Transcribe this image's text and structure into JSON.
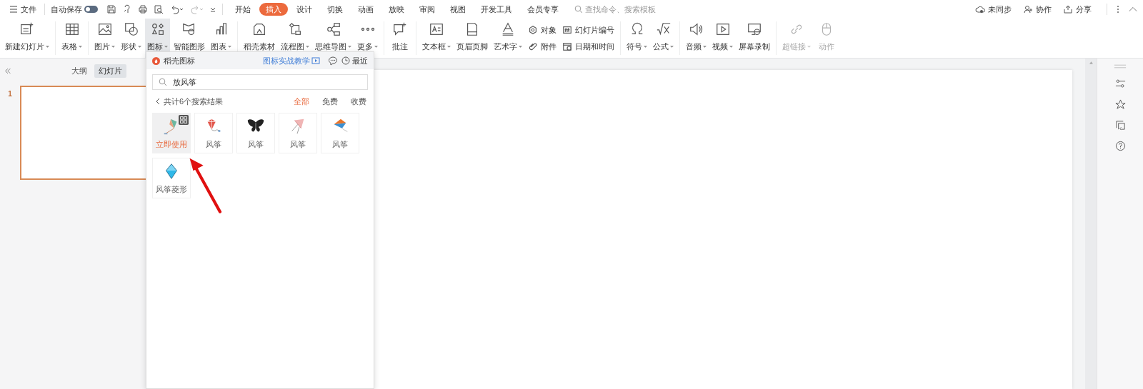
{
  "top_bar": {
    "menu": {
      "label": "文件"
    },
    "autosave": {
      "label": "自动保存",
      "on": false
    },
    "tabs": [
      {
        "label": "开始",
        "selected": false
      },
      {
        "label": "插入",
        "selected": true
      },
      {
        "label": "设计",
        "selected": false
      },
      {
        "label": "切换",
        "selected": false
      },
      {
        "label": "动画",
        "selected": false
      },
      {
        "label": "放映",
        "selected": false
      },
      {
        "label": "审阅",
        "selected": false
      },
      {
        "label": "视图",
        "selected": false
      },
      {
        "label": "开发工具",
        "selected": false
      },
      {
        "label": "会员专享",
        "selected": false
      }
    ],
    "search": {
      "placeholder": "查找命令、搜索模板"
    },
    "actions": [
      {
        "label": "未同步"
      },
      {
        "label": "协作"
      },
      {
        "label": "分享"
      }
    ]
  },
  "ribbon": {
    "groups": [
      [
        {
          "kind": "large",
          "label": "新建幻灯片",
          "dropdown": true,
          "selected": false,
          "disabled": false
        }
      ],
      [
        {
          "kind": "large",
          "label": "表格",
          "dropdown": true,
          "selected": false,
          "disabled": false
        }
      ],
      [
        {
          "kind": "large",
          "label": "图片",
          "dropdown": true,
          "selected": false,
          "disabled": false
        },
        {
          "kind": "large",
          "label": "形状",
          "dropdown": true,
          "selected": false,
          "disabled": false
        },
        {
          "kind": "large",
          "label": "图标",
          "dropdown": true,
          "selected": true,
          "disabled": false
        },
        {
          "kind": "large",
          "label": "智能图形",
          "dropdown": false,
          "selected": false,
          "disabled": false
        },
        {
          "kind": "large",
          "label": "图表",
          "dropdown": true,
          "selected": false,
          "disabled": false
        }
      ],
      [
        {
          "kind": "large",
          "label": "稻壳素材",
          "dropdown": false,
          "selected": false,
          "disabled": false
        },
        {
          "kind": "large",
          "label": "流程图",
          "dropdown": true,
          "selected": false,
          "disabled": false
        },
        {
          "kind": "large",
          "label": "思维导图",
          "dropdown": true,
          "selected": false,
          "disabled": false
        },
        {
          "kind": "large",
          "label": "更多",
          "dropdown": true,
          "selected": false,
          "disabled": false
        }
      ],
      [
        {
          "kind": "large",
          "label": "批注",
          "dropdown": false,
          "selected": false,
          "disabled": false
        }
      ],
      [
        {
          "kind": "large",
          "label": "文本框",
          "dropdown": true,
          "selected": false,
          "disabled": false
        },
        {
          "kind": "large",
          "label": "页眉页脚",
          "dropdown": false,
          "selected": false,
          "disabled": false
        },
        {
          "kind": "large",
          "label": "艺术字",
          "dropdown": true,
          "selected": false,
          "disabled": false
        },
        {
          "kind": "stack",
          "items": [
            {
              "label": "对象"
            },
            {
              "label": "附件"
            }
          ]
        },
        {
          "kind": "stack",
          "items": [
            {
              "label": "幻灯片编号"
            },
            {
              "label": "日期和时间"
            }
          ]
        }
      ],
      [
        {
          "kind": "large",
          "label": "符号",
          "dropdown": true,
          "selected": false,
          "disabled": false
        },
        {
          "kind": "large",
          "label": "公式",
          "dropdown": true,
          "selected": false,
          "disabled": false
        }
      ],
      [
        {
          "kind": "large",
          "label": "音频",
          "dropdown": true,
          "selected": false,
          "disabled": false
        },
        {
          "kind": "large",
          "label": "视频",
          "dropdown": true,
          "selected": false,
          "disabled": false
        },
        {
          "kind": "large",
          "label": "屏幕录制",
          "dropdown": false,
          "selected": false,
          "disabled": false
        }
      ],
      [
        {
          "kind": "large",
          "label": "超链接",
          "dropdown": true,
          "selected": false,
          "disabled": true
        },
        {
          "kind": "large",
          "label": "动作",
          "dropdown": false,
          "selected": false,
          "disabled": true
        }
      ]
    ]
  },
  "sidebar": {
    "tabs": [
      {
        "label": "大纲",
        "selected": false
      },
      {
        "label": "幻灯片",
        "selected": true
      }
    ],
    "slides": [
      {
        "number": "1",
        "selected": true
      }
    ]
  },
  "icon_panel": {
    "title": "稻壳图标",
    "tutorial_link": "图标实战教学",
    "recent": "最近",
    "search": {
      "value": "放风筝"
    },
    "result_count": "共计6个搜索结果",
    "filters": [
      {
        "label": "全部",
        "selected": true
      },
      {
        "label": "免费",
        "selected": false
      },
      {
        "label": "收费",
        "selected": false
      }
    ],
    "results": [
      {
        "label": "立即使用",
        "hovered": true
      },
      {
        "label": "风筝",
        "hovered": false
      },
      {
        "label": "风筝",
        "hovered": false
      },
      {
        "label": "风筝",
        "hovered": false
      },
      {
        "label": "风筝",
        "hovered": false
      },
      {
        "label": "风筝菱形",
        "hovered": false
      }
    ]
  }
}
